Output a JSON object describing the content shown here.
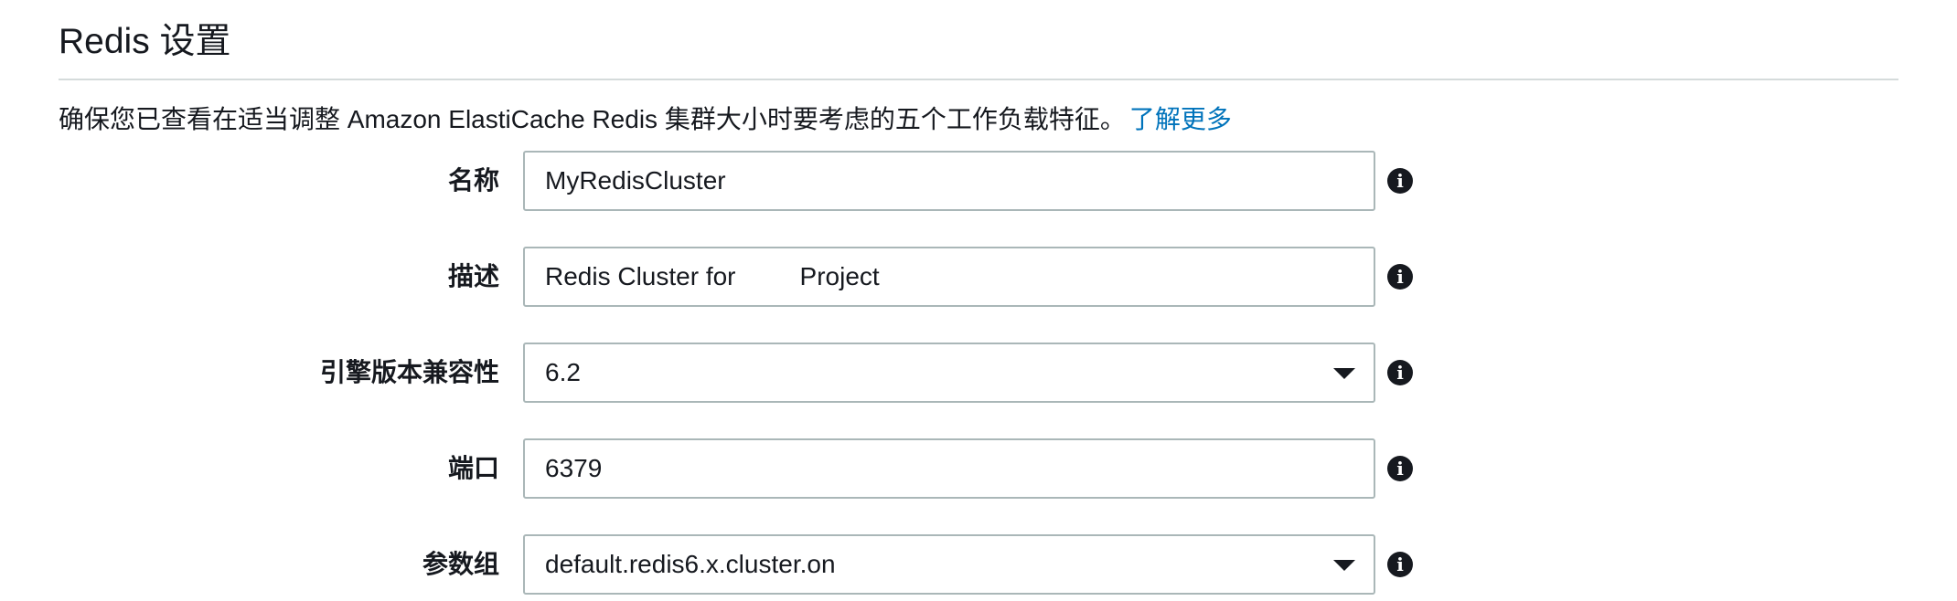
{
  "section": {
    "title": "Redis 设置",
    "description": "确保您已查看在适当调整 Amazon ElastiCache Redis 集群大小时要考虑的五个工作负载特征。",
    "learn_more_link": "了解更多"
  },
  "form": {
    "name": {
      "label": "名称",
      "value": "MyRedisCluster"
    },
    "description": {
      "label": "描述",
      "value": "Redis Cluster for         Project"
    },
    "engine_version": {
      "label": "引擎版本兼容性",
      "selected": "6.2"
    },
    "port": {
      "label": "端口",
      "value": "6379"
    },
    "parameter_group": {
      "label": "参数组",
      "selected": "default.redis6.x.cluster.on"
    }
  },
  "icons": {
    "info": "info-icon",
    "info_glyph": "i",
    "dropdown": "caret-down-icon"
  }
}
